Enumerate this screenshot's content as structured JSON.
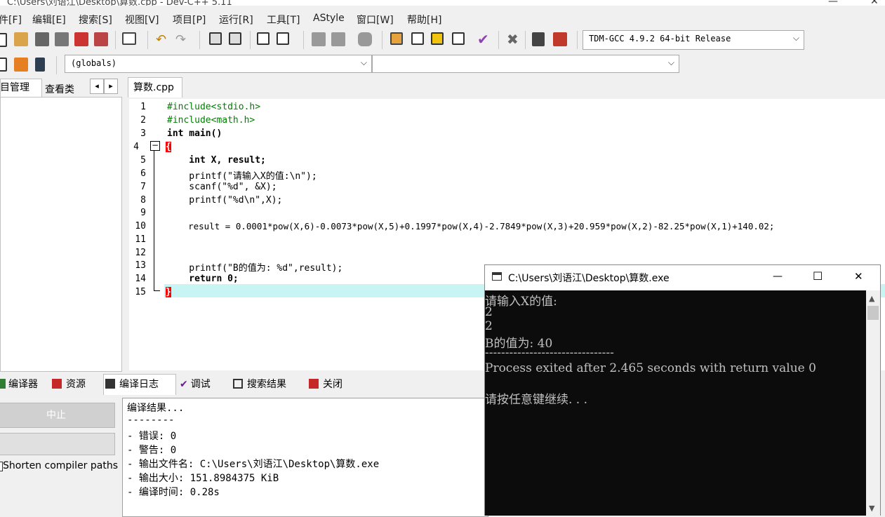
{
  "window_title": "C:\\Users\\刘语江\\Desktop\\算数.cpp - Dev-C++ 5.11",
  "menu": [
    "件[F]",
    "编辑[E]",
    "搜索[S]",
    "视图[V]",
    "项目[P]",
    "运行[R]",
    "工具[T]",
    "AStyle",
    "窗口[W]",
    "帮助[H]"
  ],
  "toolbar": {
    "compiler_select": "TDM-GCC 4.9.2 64-bit Release",
    "scope_select": "(globals)",
    "member_select": ""
  },
  "left_panel": {
    "tab_project": "目管理",
    "tab_classes": "查看类",
    "prev": "◂",
    "next": "▸"
  },
  "editor": {
    "file_tab": "算数.cpp",
    "line_numbers": [
      "1",
      "2",
      "3",
      "4",
      "5",
      "6",
      "7",
      "8",
      "9",
      "10",
      "11",
      "12",
      "13",
      "14",
      "15"
    ],
    "code_lines": [
      "#include<stdio.h>",
      "#include<math.h>",
      "int main()",
      "{",
      "    int X, result;",
      "    printf(\"请输入X的值:\\n\");",
      "    scanf(\"%d\", &X);",
      "    printf(\"%d\\n\",X);",
      "",
      "    result = 0.0001*pow(X,6)-0.0073*pow(X,5)+0.1997*pow(X,4)-2.7849*pow(X,3)+20.959*pow(X,2)-82.25*pow(X,1)+140.02;",
      "",
      "",
      "    printf(\"B的值为: %d\",result);",
      "    return 0;",
      "}"
    ]
  },
  "bottom": {
    "tabs": [
      "编译器",
      "资源",
      "编译日志",
      "调试",
      "搜索结果",
      "关闭"
    ],
    "abort_button": "中止",
    "shorten_paths": "Shorten compiler paths",
    "log_lines": [
      "编译结果...",
      "--------",
      "- 错误: 0",
      "- 警告: 0",
      "- 输出文件名: C:\\Users\\刘语江\\Desktop\\算数.exe",
      "- 输出大小: 151.8984375 KiB",
      "- 编译时间: 0.28s"
    ]
  },
  "console": {
    "title": "C:\\Users\\刘语江\\Desktop\\算数.exe",
    "minimize": "—",
    "maximize": "☐",
    "close": "✕",
    "lines": [
      "请输入X的值:",
      "2",
      "2",
      "B的值为: 40",
      "--------------------------------",
      "Process exited after 2.465 seconds with return value 0",
      "",
      "请按任意键继续. . ."
    ]
  }
}
